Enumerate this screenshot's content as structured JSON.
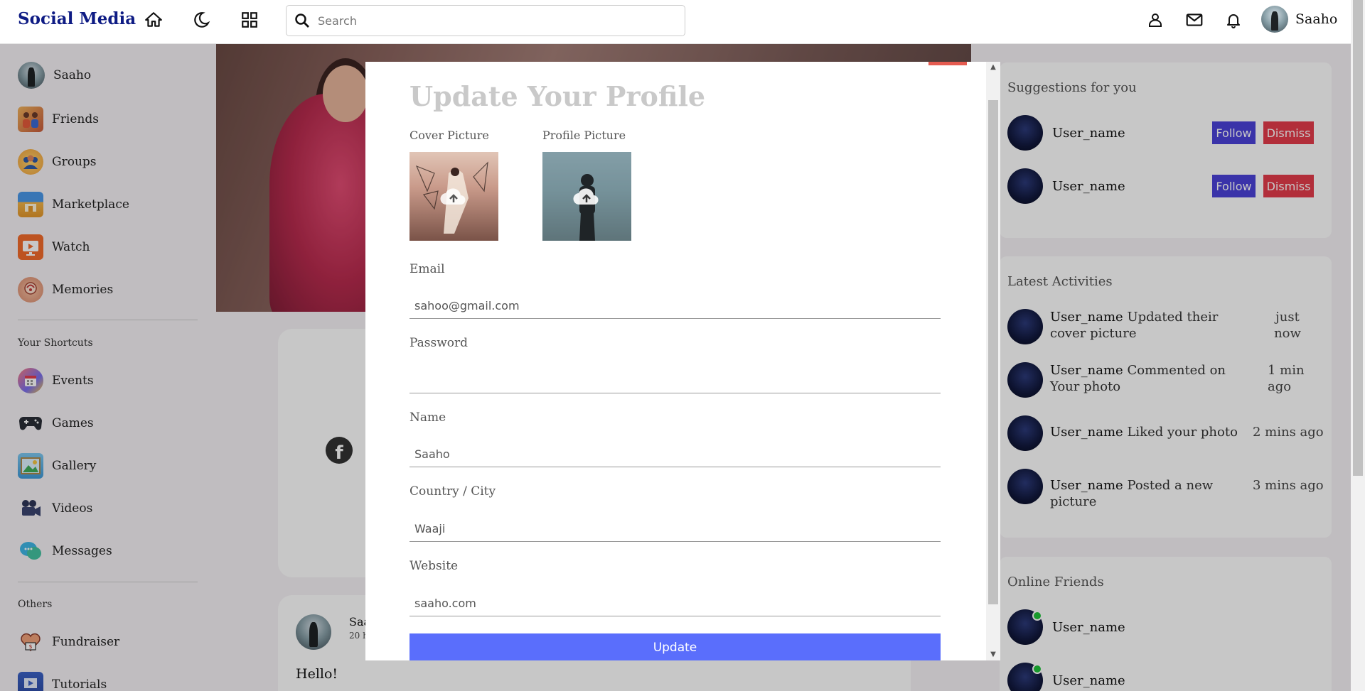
{
  "app": {
    "logo": "Social Media"
  },
  "navbar": {
    "search_placeholder": "Search",
    "user_name": "Saaho"
  },
  "left_sidebar": {
    "user_name": "Saaho",
    "items": [
      {
        "label": "Friends",
        "icon": "friends-icon"
      },
      {
        "label": "Groups",
        "icon": "groups-icon"
      },
      {
        "label": "Marketplace",
        "icon": "marketplace-icon"
      },
      {
        "label": "Watch",
        "icon": "watch-icon"
      },
      {
        "label": "Memories",
        "icon": "memories-icon"
      }
    ],
    "shortcuts_heading": "Your Shortcuts",
    "shortcuts": [
      {
        "label": "Events",
        "icon": "events-icon"
      },
      {
        "label": "Games",
        "icon": "games-icon"
      },
      {
        "label": "Gallery",
        "icon": "gallery-icon"
      },
      {
        "label": "Videos",
        "icon": "videos-icon"
      },
      {
        "label": "Messages",
        "icon": "messages-icon"
      }
    ],
    "others_heading": "Others",
    "others": [
      {
        "label": "Fundraiser",
        "icon": "fundraiser-icon"
      },
      {
        "label": "Tutorials",
        "icon": "tutorials-icon"
      }
    ]
  },
  "post": {
    "author": "Saa",
    "time": "20 h",
    "text": "Hello!"
  },
  "right_sidebar": {
    "suggestions": {
      "title": "Suggestions for you",
      "users": [
        {
          "name": "User_name",
          "follow": "Follow",
          "dismiss": "Dismiss"
        },
        {
          "name": "User_name",
          "follow": "Follow",
          "dismiss": "Dismiss"
        }
      ]
    },
    "activities": {
      "title": "Latest Activities",
      "items": [
        {
          "name": "User_name",
          "text": "Updated their cover picture",
          "time": "just now"
        },
        {
          "name": "User_name",
          "text": "Commented on Your photo",
          "time": "1 min ago"
        },
        {
          "name": "User_name",
          "text": "Liked your photo",
          "time": "2 mins ago"
        },
        {
          "name": "User_name",
          "text": "Posted a new picture",
          "time": "3 mins ago"
        }
      ]
    },
    "online": {
      "title": "Online Friends",
      "users": [
        {
          "name": "User_name"
        },
        {
          "name": "User_name"
        }
      ]
    }
  },
  "modal": {
    "title": "Update Your Profile",
    "cover_label": "Cover Picture",
    "profile_label": "Profile Picture",
    "email_label": "Email",
    "email_value": "sahoo@gmail.com",
    "password_label": "Password",
    "password_value": "",
    "name_label": "Name",
    "name_value": "Saaho",
    "country_label": "Country / City",
    "country_value": "Waaji",
    "website_label": "Website",
    "website_value": "saaho.com",
    "update_label": "Update"
  },
  "colors": {
    "logo": "#0e1b84",
    "follow": "#4b42d9",
    "dismiss": "#e53b4b",
    "update": "#5a6efc",
    "online": "#1fc43a"
  }
}
